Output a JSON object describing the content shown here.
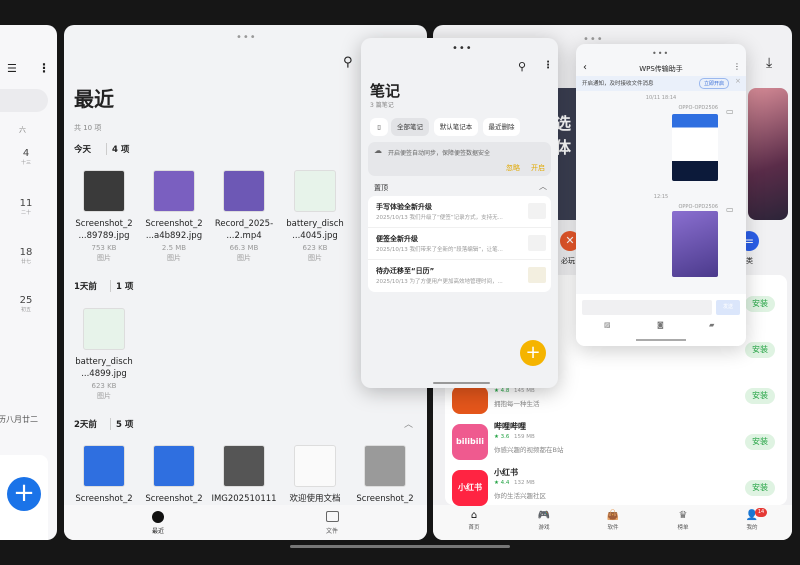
{
  "calendar": {
    "weekday": "六",
    "days": [
      {
        "num": "4",
        "lunar": "十三"
      },
      {
        "num": "11",
        "lunar": "二十"
      },
      {
        "num": "18",
        "lunar": "廿七"
      },
      {
        "num": "25",
        "lunar": "初五"
      }
    ],
    "lunar_footer": "历八月廿二",
    "add_label": "+"
  },
  "files": {
    "title": "最近",
    "total": "共 10 项",
    "groups": [
      {
        "label": "今天",
        "count": "4 项",
        "items": [
          {
            "name1": "Screenshot_2",
            "name2": "...89789.jpg",
            "size": "753 KB",
            "type": "图片",
            "color": "#3a3a3a"
          },
          {
            "name1": "Screenshot_2",
            "name2": "...a4b892.jpg",
            "size": "2.5 MB",
            "type": "图片",
            "color": "#7a5fc0"
          },
          {
            "name1": "Record_2025-",
            "name2": "...2.mp4",
            "size": "66.3 MB",
            "type": "图片",
            "color": "#6d58b5"
          },
          {
            "name1": "battery_disch",
            "name2": "...4045.jpg",
            "size": "623 KB",
            "type": "图片",
            "color": "#e7f3ea"
          }
        ]
      },
      {
        "label": "1天前",
        "count": "1 项",
        "items": [
          {
            "name1": "battery_disch",
            "name2": "...4899.jpg",
            "size": "623 KB",
            "type": "图片",
            "color": "#e7f3ea"
          }
        ]
      },
      {
        "label": "2天前",
        "count": "5 项",
        "items": [
          {
            "name1": "Screenshot_2",
            "color": "#2f6fe0"
          },
          {
            "name1": "Screenshot_2",
            "color": "#2f6fe0"
          },
          {
            "name1": "IMG202510111",
            "color": "#555"
          },
          {
            "name1": "欢迎使用文档",
            "color": "#fafafa"
          },
          {
            "name1": "Screenshot_2",
            "color": "#9a9a9a"
          }
        ]
      }
    ],
    "nav": {
      "recent": "最近",
      "files": "文件"
    }
  },
  "notes": {
    "title": "笔记",
    "count": "3 篇笔记",
    "chips": [
      "全部笔记",
      "默认笔记本",
      "最近删除"
    ],
    "sync_banner": {
      "text": "开启便签自动同步，保障便签数据安全",
      "ignore": "忽略",
      "enable": "开启"
    },
    "pinned_label": "置顶",
    "items": [
      {
        "title": "手写体验全新升级",
        "preview": "2025/10/13 我们升级了“便签”记录方式，支持无..."
      },
      {
        "title": "便签全新升级",
        "preview": "2025/10/13 我们带来了全新的“段落编辑”，让笔..."
      },
      {
        "title": "待办迁移至“日历”",
        "preview": "2025/10/13 为了方便用户更加高效地管理时间，..."
      }
    ],
    "fab": "+",
    "accent": "#f5b400"
  },
  "wps": {
    "title": "WPS传输助手",
    "notice": "开启通知，及时接收文件消息",
    "notice_btn": "立即开启",
    "messages": [
      {
        "time": "10/11 18:14",
        "sender": "OPPO-OPD2506"
      },
      {
        "time": "12:15",
        "sender": "OPPO-OPD2506"
      }
    ],
    "send": "发送"
  },
  "store": {
    "banner_text": "选\n体",
    "shortcuts": [
      "必玩",
      "类"
    ],
    "apps": [
      {
        "name": "",
        "rating": "★ 4.8",
        "size": "145 MB",
        "desc": "拥抱每一种生活",
        "color": "#e4561b",
        "icon_text": ""
      },
      {
        "name": "哔哩哔哩",
        "rating": "★ 3.6",
        "size": "159 MB",
        "desc": "你感兴趣的视频都在B站",
        "color": "#ef5a8f",
        "icon_text": "bilibili"
      },
      {
        "name": "小红书",
        "rating": "★ 4.4",
        "size": "132 MB",
        "desc": "你的生活兴趣社区",
        "color": "#ff2442",
        "icon_text": "小红书"
      }
    ],
    "install": "安装",
    "nav": [
      "首页",
      "游戏",
      "软件",
      "榜单",
      "我的"
    ],
    "badge": "14"
  }
}
